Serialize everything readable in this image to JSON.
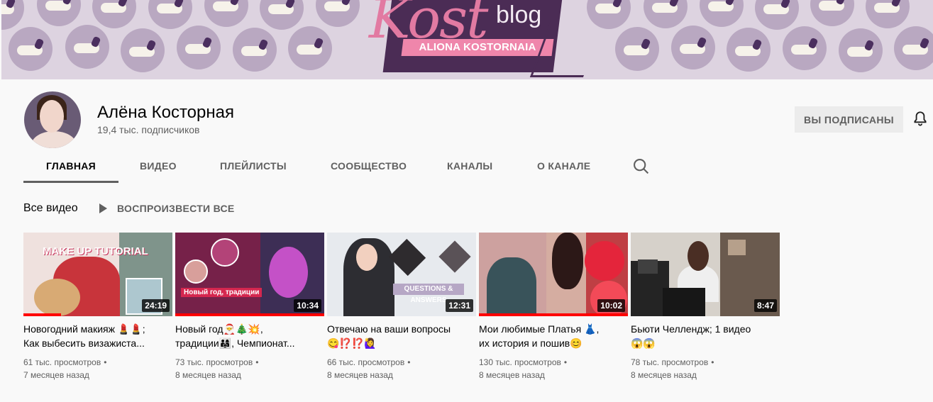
{
  "banner": {
    "script_text": "Kost",
    "blog_text": "blog",
    "ribbon_text": "ALIONA KOSTORNAIA"
  },
  "channel": {
    "name": "Алёна Косторная",
    "subscribers": "19,4 тыс. подписчиков",
    "subscribed_label": "ВЫ ПОДПИСАНЫ",
    "bell_icon": "bell-icon"
  },
  "tabs": [
    {
      "label": "ГЛАВНАЯ",
      "active": true
    },
    {
      "label": "ВИДЕО",
      "active": false
    },
    {
      "label": "ПЛЕЙЛИСТЫ",
      "active": false
    },
    {
      "label": "СООБЩЕСТВО",
      "active": false
    },
    {
      "label": "КАНАЛЫ",
      "active": false
    },
    {
      "label": "О КАНАЛЕ",
      "active": false
    }
  ],
  "search_icon": "search-icon",
  "section": {
    "title": "Все видео",
    "play_all_label": "ВОСПРОИЗВЕСТИ ВСЕ",
    "play_icon": "play-icon"
  },
  "videos": [
    {
      "line1": "Новогодний макияж 💄💄;",
      "line2": "Как выбесить визажиста...",
      "views": "61 тыс. просмотров",
      "age": "7 месяцев назад",
      "duration": "24:19",
      "watched_fraction": 0.25,
      "thumb_text": "MAKE UP TUTORIAL"
    },
    {
      "line1": "Новый год🎅🎄💥,",
      "line2": "традиции👨‍👩‍👧, Чемпионат...",
      "views": "73 тыс. просмотров",
      "age": "8 месяцев назад",
      "duration": "10:34",
      "watched_fraction": 1,
      "thumb_text": "Новый год, традиции"
    },
    {
      "line1": "Отвечаю на ваши вопросы",
      "line2": "😋⁉️⁉️🙋‍♀️",
      "views": "66 тыс. просмотров",
      "age": "8 месяцев назад",
      "duration": "12:31",
      "watched_fraction": 0,
      "thumb_text": "QUESTIONS & ANSWERS"
    },
    {
      "line1": "Мои любимые Платья 👗,",
      "line2": "их история и пошив😊",
      "views": "130 тыс. просмотров",
      "age": "8 месяцев назад",
      "duration": "10:02",
      "watched_fraction": 1,
      "thumb_text": ""
    },
    {
      "line1": "Бьюти Челлендж; 1 видео",
      "line2": "😱😱",
      "views": "78 тыс. просмотров",
      "age": "8 месяцев назад",
      "duration": "8:47",
      "watched_fraction": 0,
      "thumb_text": ""
    }
  ]
}
